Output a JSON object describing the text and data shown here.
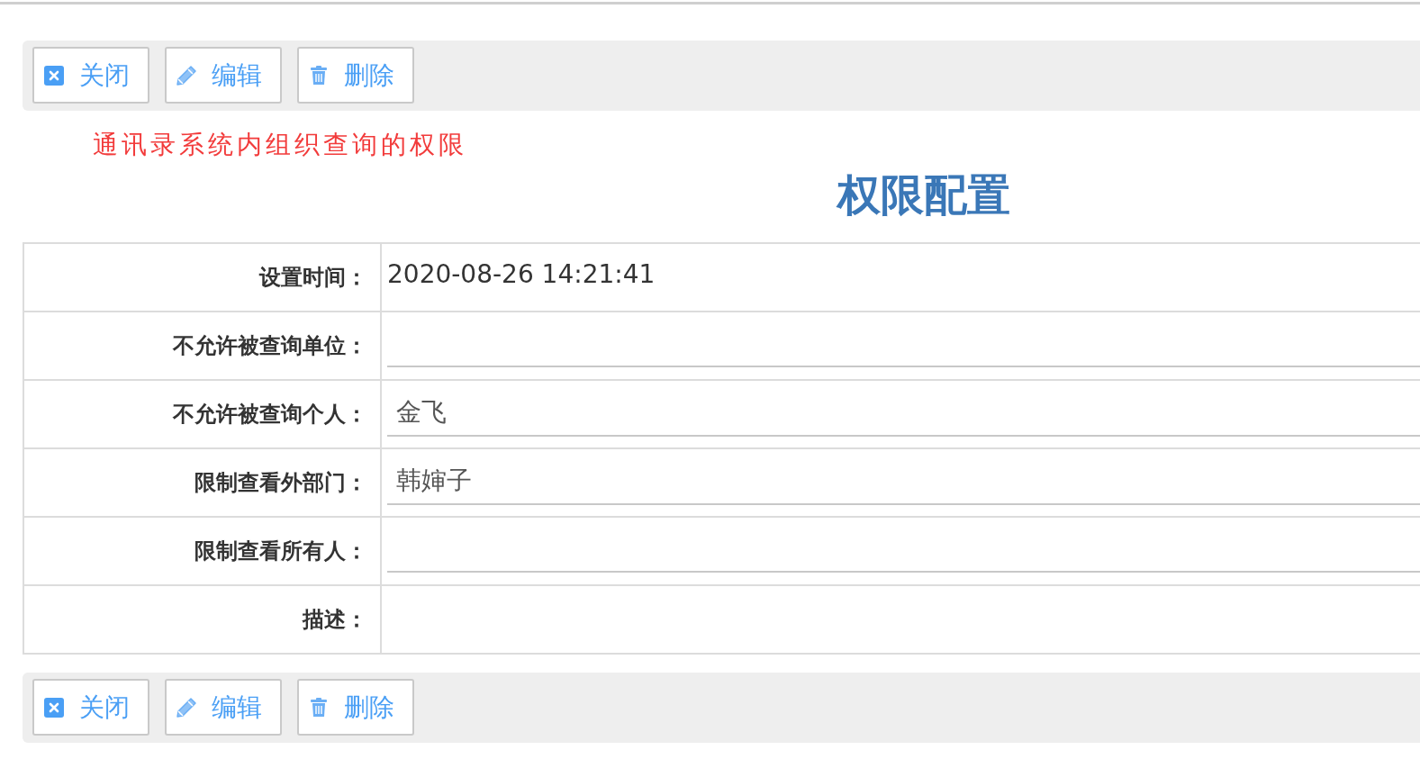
{
  "top_toolbar": {
    "buttons": [
      {
        "kind": "close",
        "label": "关闭"
      },
      {
        "kind": "edit",
        "label": "编辑"
      },
      {
        "kind": "delete",
        "label": "删除"
      }
    ]
  },
  "note": "通讯录系统内组织查询的权限",
  "title": "权限配置",
  "form": {
    "rows": [
      {
        "label": "设置时间：",
        "kind": "text",
        "value": "2020-08-26 14:21:41"
      },
      {
        "label": "不允许被查询单位：",
        "kind": "input"
      },
      {
        "label": "不允许被查询个人：",
        "kind": "input",
        "value": "金飞"
      },
      {
        "label": "限制查看外部门：",
        "kind": "input",
        "value": "韩婶子"
      },
      {
        "label": "限制查看所有人：",
        "kind": "input"
      },
      {
        "label": "描述：",
        "kind": "text"
      }
    ]
  },
  "bottom_toolbar": {
    "buttons": [
      {
        "kind": "close",
        "label": "关闭"
      },
      {
        "kind": "edit",
        "label": "编辑"
      },
      {
        "kind": "delete",
        "label": "删除"
      }
    ]
  }
}
